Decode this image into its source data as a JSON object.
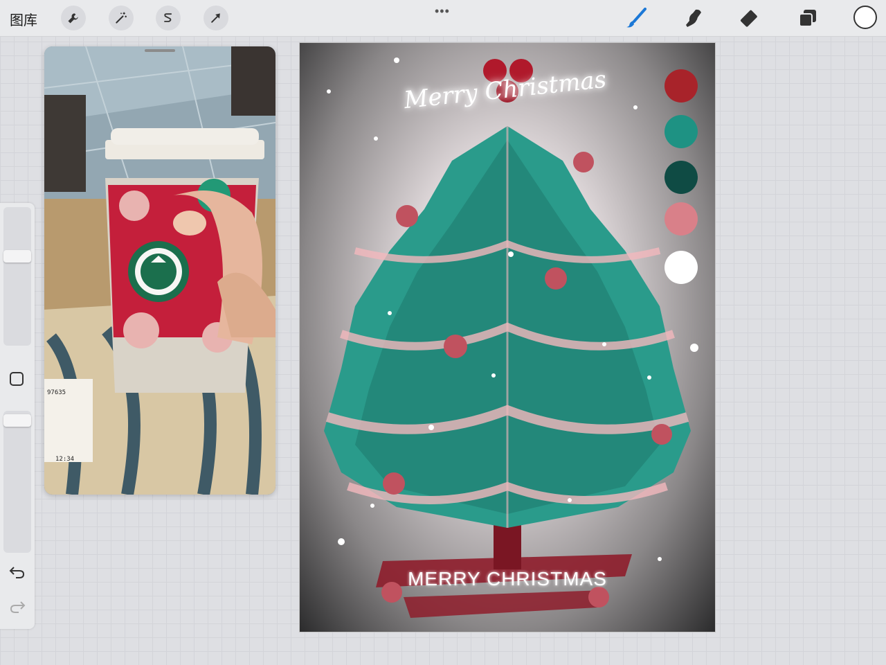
{
  "toolbar": {
    "gallery_label": "图库",
    "more_label": "•••"
  },
  "canvas": {
    "title_script": "Merry Christmas",
    "title_bottom": "MERRY CHRISTMAS"
  },
  "reference": {
    "receipt_code": "97635",
    "receipt_time": "12:34"
  },
  "palette": [
    "#a8232a",
    "#1e9283",
    "#0f4b44",
    "#d98089",
    "#ffffff"
  ],
  "colors": {
    "active_brush": "#1c78d6",
    "tree_green": "#2a9b8b",
    "tree_pink": "#f2b8bd",
    "trunk_red": "#8e1d2b"
  }
}
